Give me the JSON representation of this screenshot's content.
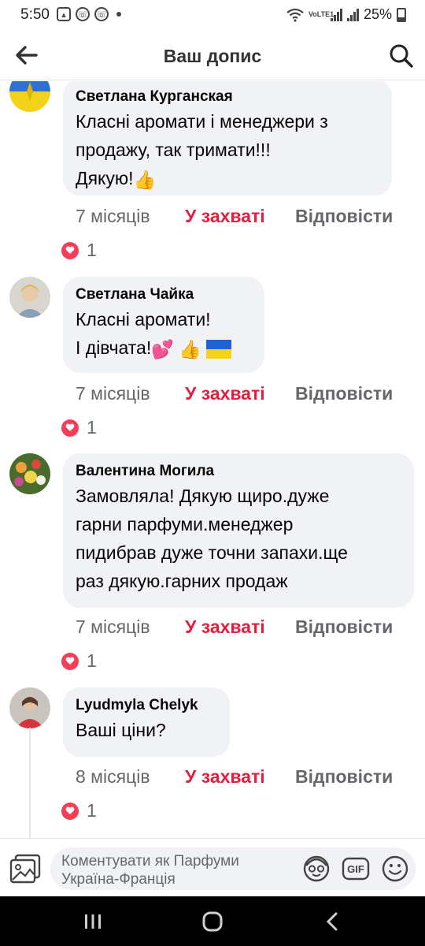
{
  "status_bar": {
    "time": "5:50",
    "battery": "25%",
    "network": "VoLTE1"
  },
  "header": {
    "title": "Ваш допис"
  },
  "comments": [
    {
      "author": "Светлана Курганская",
      "lines": [
        "Класні аромати і менеджери з",
        "продажу, так тримати!!!",
        "Дякую!"
      ],
      "time": "7 місяців",
      "like": "У захваті",
      "reply": "Відповісти",
      "reactions": "1"
    },
    {
      "author": "Светлана Чайка",
      "lines": [
        "Класні аромати!",
        "І дівчата!"
      ],
      "time": "7 місяців",
      "like": "У захваті",
      "reply": "Відповісти",
      "reactions": "1"
    },
    {
      "author": "Валентина Могила",
      "lines": [
        "Замовляла! Дякую щиро.дуже",
        "гарни парфуми.менеджер",
        "пидибрав дуже точни запахи.ще",
        "раз дякую.гарних продаж"
      ],
      "time": "7 місяців",
      "like": "У захваті",
      "reply": "Відповісти",
      "reactions": "1"
    },
    {
      "author": "Lyudmyla Chelyk",
      "lines": [
        "Ваші ціни?"
      ],
      "time": "8 місяців",
      "like": "У захваті",
      "reply": "Відповісти",
      "reactions": "1"
    }
  ],
  "composer": {
    "placeholder": "Коментувати як Парфуми Україна-Франція"
  },
  "colors": {
    "like_red": "#e41e3f",
    "bubble_bg": "#f0f2f5",
    "meta_gray": "#65676b",
    "heart": "#f33e58"
  }
}
